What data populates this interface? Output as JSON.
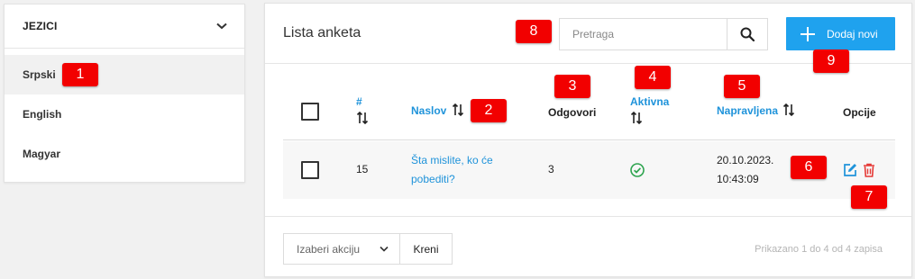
{
  "sidebar": {
    "title": "JEZICI",
    "items": [
      {
        "label": "Srpski",
        "active": true
      },
      {
        "label": "English",
        "active": false
      },
      {
        "label": "Magyar",
        "active": false
      }
    ]
  },
  "panel": {
    "title": "Lista anketa",
    "search_placeholder": "Pretraga",
    "search_value": "",
    "add_button": "Dodaj novi"
  },
  "table": {
    "columns": {
      "id": "#",
      "title": "Naslov",
      "answers": "Odgovori",
      "active": "Aktivna",
      "created": "Napravljena",
      "options": "Opcije"
    },
    "rows": [
      {
        "id": "15",
        "title_line1": "Šta mislite, ko će",
        "title_line2": "pobediti?",
        "answers": "3",
        "active": true,
        "created_date": "20.10.2023.",
        "created_time": "10:43:09"
      }
    ]
  },
  "footer": {
    "bulk_action": "Izaberi akciju",
    "go_button": "Kreni",
    "info": "Prikazano 1 do 4 od 4 zapisa"
  },
  "markers": [
    "1",
    "2",
    "3",
    "4",
    "5",
    "6",
    "7",
    "8",
    "9"
  ],
  "colors": {
    "accent": "#1fa2ee",
    "link": "#1f93da",
    "success": "#2ea44f",
    "danger": "#e53935",
    "marker": "#f20000"
  },
  "icons": {
    "chevron": "chevron-down-icon",
    "search": "search-icon",
    "plus": "plus-icon",
    "sort": "sort-icon",
    "check": "check-circle-icon",
    "edit": "edit-icon",
    "delete": "trash-icon"
  }
}
